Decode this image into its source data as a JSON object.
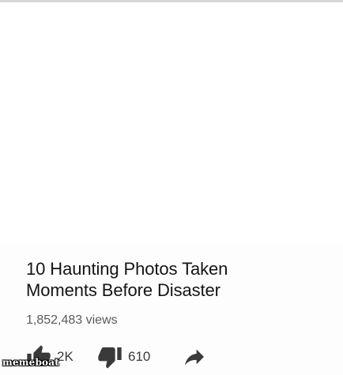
{
  "video": {
    "title_line1": "10 Haunting Photos Taken",
    "title_line2": "Moments Before Disaster",
    "views": "1,852,483 views"
  },
  "actions": {
    "like_count": "2K",
    "dislike_count": "610",
    "like_icon": "thumbs-up-icon",
    "dislike_icon": "thumbs-down-icon",
    "share_icon": "share-arrow-icon"
  },
  "watermark": {
    "text": "memeboat"
  },
  "colors": {
    "title": "#141414",
    "meta": "#5a5a5a",
    "icon": "#3a3a3a",
    "background": "#ffffff"
  }
}
